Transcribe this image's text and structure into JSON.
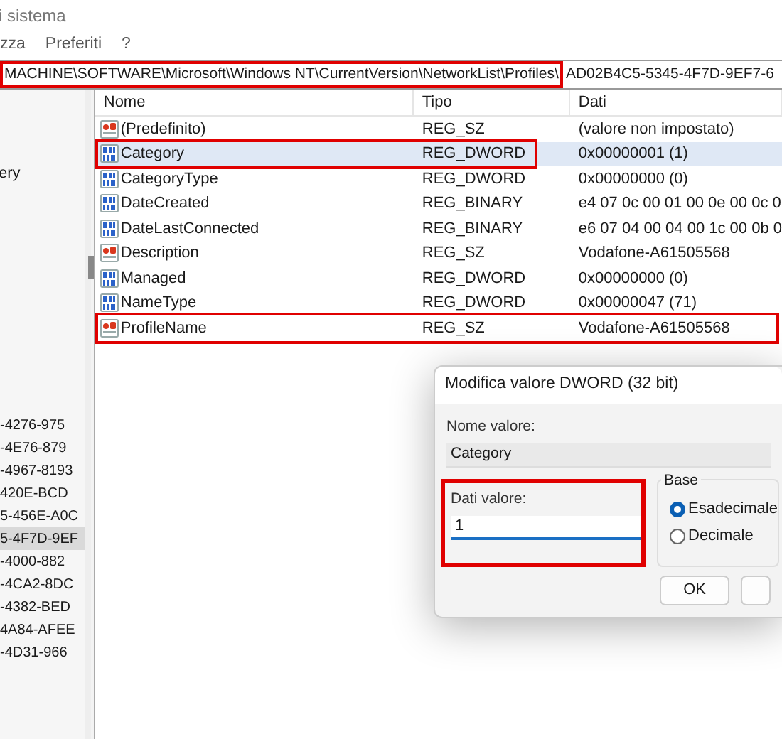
{
  "window": {
    "title": "i sistema"
  },
  "menu": [
    "zza",
    "Preferiti",
    "?"
  ],
  "address": {
    "path": "MACHINE\\SOFTWARE\\Microsoft\\Windows NT\\CurrentVersion\\NetworkList\\Profiles\\",
    "rest": "AD02B4C5-5345-4F7D-9EF7-6",
    "highlighted": true
  },
  "tree": {
    "top_item": "ery",
    "items": [
      {
        "label": "-4276-975",
        "selected": false
      },
      {
        "label": "-4E76-879",
        "selected": false
      },
      {
        "label": "-4967-8193",
        "selected": false
      },
      {
        "label": "420E-BCD",
        "selected": false
      },
      {
        "label": "5-456E-A0C",
        "selected": false
      },
      {
        "label": "5-4F7D-9EF",
        "selected": true
      },
      {
        "label": "-4000-882",
        "selected": false
      },
      {
        "label": "-4CA2-8DC",
        "selected": false
      },
      {
        "label": "-4382-BED",
        "selected": false
      },
      {
        "label": "4A84-AFEE",
        "selected": false
      },
      {
        "label": "-4D31-966",
        "selected": false
      }
    ]
  },
  "table": {
    "columns": [
      "Nome",
      "Tipo",
      "Dati"
    ],
    "rows": [
      {
        "kind": "string",
        "name": "(Predefinito)",
        "type": "REG_SZ",
        "data": "(valore non impostato)",
        "selected": false,
        "highlighted": false
      },
      {
        "kind": "binary",
        "name": "Category",
        "type": "REG_DWORD",
        "data": "0x00000001 (1)",
        "selected": true,
        "highlighted": true,
        "highlight_covers_data": false
      },
      {
        "kind": "binary",
        "name": "CategoryType",
        "type": "REG_DWORD",
        "data": "0x00000000 (0)",
        "selected": false,
        "highlighted": false
      },
      {
        "kind": "binary",
        "name": "DateCreated",
        "type": "REG_BINARY",
        "data": "e4 07 0c 00 01 00 0e 00 0c 0",
        "selected": false,
        "highlighted": false
      },
      {
        "kind": "binary",
        "name": "DateLastConnected",
        "type": "REG_BINARY",
        "data": "e6 07 04 00 04 00 1c 00 0b 0",
        "selected": false,
        "highlighted": false
      },
      {
        "kind": "string",
        "name": "Description",
        "type": "REG_SZ",
        "data": "Vodafone-A61505568",
        "selected": false,
        "highlighted": false
      },
      {
        "kind": "binary",
        "name": "Managed",
        "type": "REG_DWORD",
        "data": "0x00000000 (0)",
        "selected": false,
        "highlighted": false
      },
      {
        "kind": "binary",
        "name": "NameType",
        "type": "REG_DWORD",
        "data": "0x00000047 (71)",
        "selected": false,
        "highlighted": false
      },
      {
        "kind": "string",
        "name": "ProfileName",
        "type": "REG_SZ",
        "data": "Vodafone-A61505568",
        "selected": false,
        "highlighted": true,
        "highlight_covers_data": true
      }
    ]
  },
  "dialog": {
    "title": "Modifica valore DWORD (32 bit)",
    "name_label": "Nome valore:",
    "name_value": "Category",
    "data_label": "Dati valore:",
    "data_value": "1",
    "data_highlighted": true,
    "base_label": "Base",
    "bases": [
      {
        "label": "Esadecimale",
        "selected": true
      },
      {
        "label": "Decimale",
        "selected": false
      }
    ],
    "ok": "OK"
  }
}
